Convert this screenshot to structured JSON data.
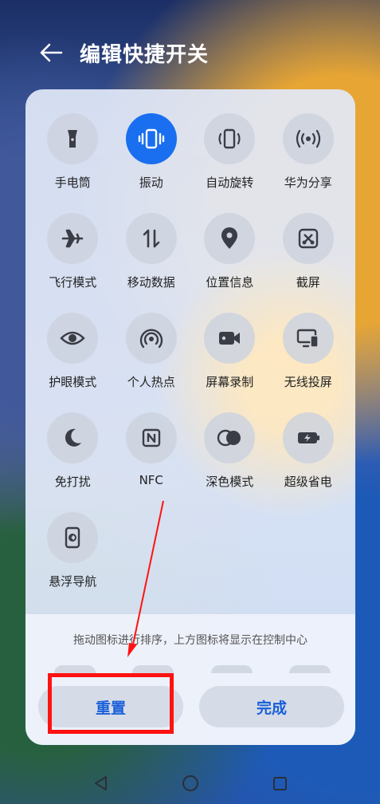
{
  "header": {
    "title": "编辑快捷开关"
  },
  "tiles": [
    {
      "label": "手电筒",
      "icon": "flashlight-icon",
      "active": false
    },
    {
      "label": "振动",
      "icon": "vibrate-icon",
      "active": true
    },
    {
      "label": "自动旋转",
      "icon": "auto-rotate-icon",
      "active": false
    },
    {
      "label": "华为分享",
      "icon": "huawei-share-icon",
      "active": false
    },
    {
      "label": "飞行模式",
      "icon": "airplane-icon",
      "active": false
    },
    {
      "label": "移动数据",
      "icon": "mobile-data-icon",
      "active": false
    },
    {
      "label": "位置信息",
      "icon": "location-icon",
      "active": false
    },
    {
      "label": "截屏",
      "icon": "screenshot-icon",
      "active": false
    },
    {
      "label": "护眼模式",
      "icon": "eye-icon",
      "active": false
    },
    {
      "label": "个人热点",
      "icon": "hotspot-icon",
      "active": false
    },
    {
      "label": "屏幕录制",
      "icon": "screen-record-icon",
      "active": false
    },
    {
      "label": "无线投屏",
      "icon": "wireless-projection-icon",
      "active": false
    },
    {
      "label": "免打扰",
      "icon": "moon-icon",
      "active": false
    },
    {
      "label": "NFC",
      "icon": "nfc-icon",
      "active": false
    },
    {
      "label": "深色模式",
      "icon": "dark-mode-icon",
      "active": false
    },
    {
      "label": "超级省电",
      "icon": "battery-saver-icon",
      "active": false
    },
    {
      "label": "悬浮导航",
      "icon": "floating-nav-icon",
      "active": false
    }
  ],
  "panel": {
    "hint": "拖动图标进行排序，上方图标将显示在控制中心",
    "reset_label": "重置",
    "done_label": "完成"
  },
  "colors": {
    "accent": "#1a6ff0",
    "annotation": "#ff1212"
  }
}
